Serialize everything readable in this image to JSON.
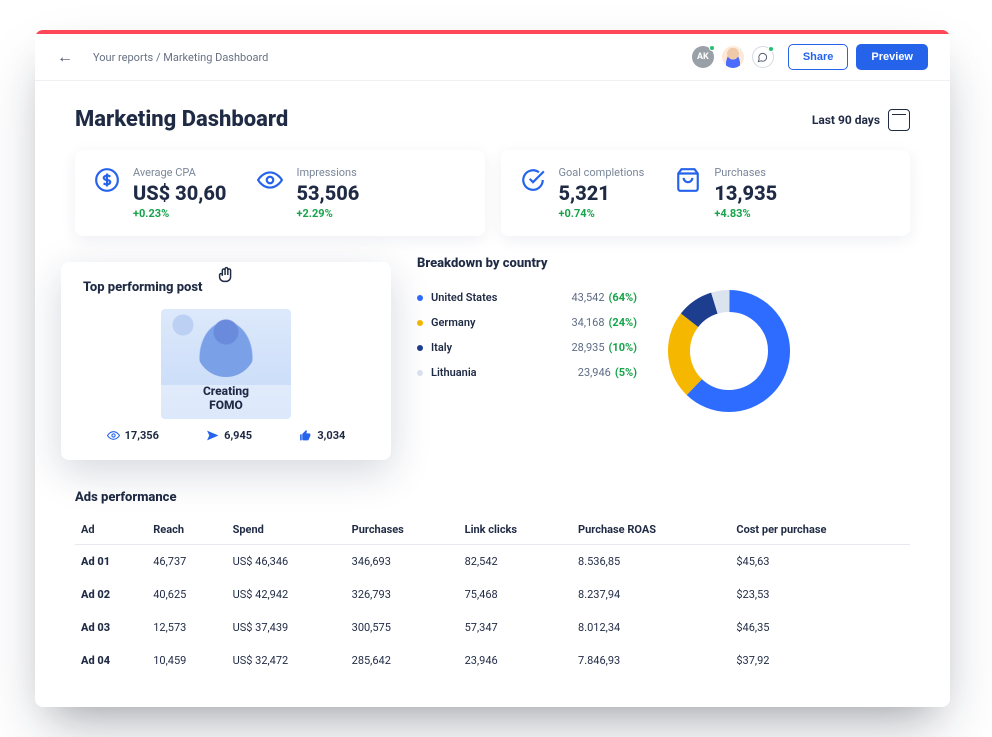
{
  "breadcrumb": "Your reports / Marketing Dashboard",
  "avatars": {
    "initials": "AK"
  },
  "buttons": {
    "share": "Share",
    "preview": "Preview"
  },
  "title": "Marketing Dashboard",
  "date_range": "Last 90 days",
  "kpi": {
    "cpa": {
      "label": "Average CPA",
      "value": "US$ 30,60",
      "delta": "+0.23%"
    },
    "impressions": {
      "label": "Impressions",
      "value": "53,506",
      "delta": "+2.29%"
    },
    "goals": {
      "label": "Goal completions",
      "value": "5,321",
      "delta": "+0.74%"
    },
    "purchases": {
      "label": "Purchases",
      "value": "13,935",
      "delta": "+4.83%"
    }
  },
  "top_post": {
    "heading": "Top performing post",
    "caption_line1": "Creating",
    "caption_line2": "FOMO",
    "views": "17,356",
    "shares": "6,945",
    "likes": "3,034"
  },
  "breakdown": {
    "heading": "Breakdown by country",
    "rows": [
      {
        "name": "United States",
        "value": "43,542",
        "pct": "(64%)",
        "color": "#2e6bff"
      },
      {
        "name": "Germany",
        "value": "34,168",
        "pct": "(24%)",
        "color": "#f5b700"
      },
      {
        "name": "Italy",
        "value": "28,935",
        "pct": "(10%)",
        "color": "#1d3d8f"
      },
      {
        "name": "Lithuania",
        "value": "23,946",
        "pct": "(5%)",
        "color": "#dbe3ef"
      }
    ]
  },
  "ads": {
    "heading": "Ads performance",
    "columns": [
      "Ad",
      "Reach",
      "Spend",
      "Purchases",
      "Link clicks",
      "Purchase ROAS",
      "Cost per purchase"
    ],
    "rows": [
      [
        "Ad 01",
        "46,737",
        "US$ 46,346",
        "346,693",
        "82,542",
        "8.536,85",
        "$45,63"
      ],
      [
        "Ad 02",
        "40,625",
        "US$ 42,942",
        "326,793",
        "75,468",
        "8.237,94",
        "$23,53"
      ],
      [
        "Ad 03",
        "12,573",
        "US$ 37,439",
        "300,575",
        "57,347",
        "8.012,34",
        "$46,35"
      ],
      [
        "Ad 04",
        "10,459",
        "US$ 32,472",
        "285,642",
        "23,946",
        "7.846,93",
        "$37,92"
      ]
    ]
  },
  "chart_data": {
    "type": "pie",
    "title": "Breakdown by country",
    "series": [
      {
        "name": "United States",
        "value": 43542,
        "pct": 64,
        "color": "#2e6bff"
      },
      {
        "name": "Germany",
        "value": 34168,
        "pct": 24,
        "color": "#f5b700"
      },
      {
        "name": "Italy",
        "value": 28935,
        "pct": 10,
        "color": "#1d3d8f"
      },
      {
        "name": "Lithuania",
        "value": 23946,
        "pct": 5,
        "color": "#dbe3ef"
      }
    ]
  }
}
